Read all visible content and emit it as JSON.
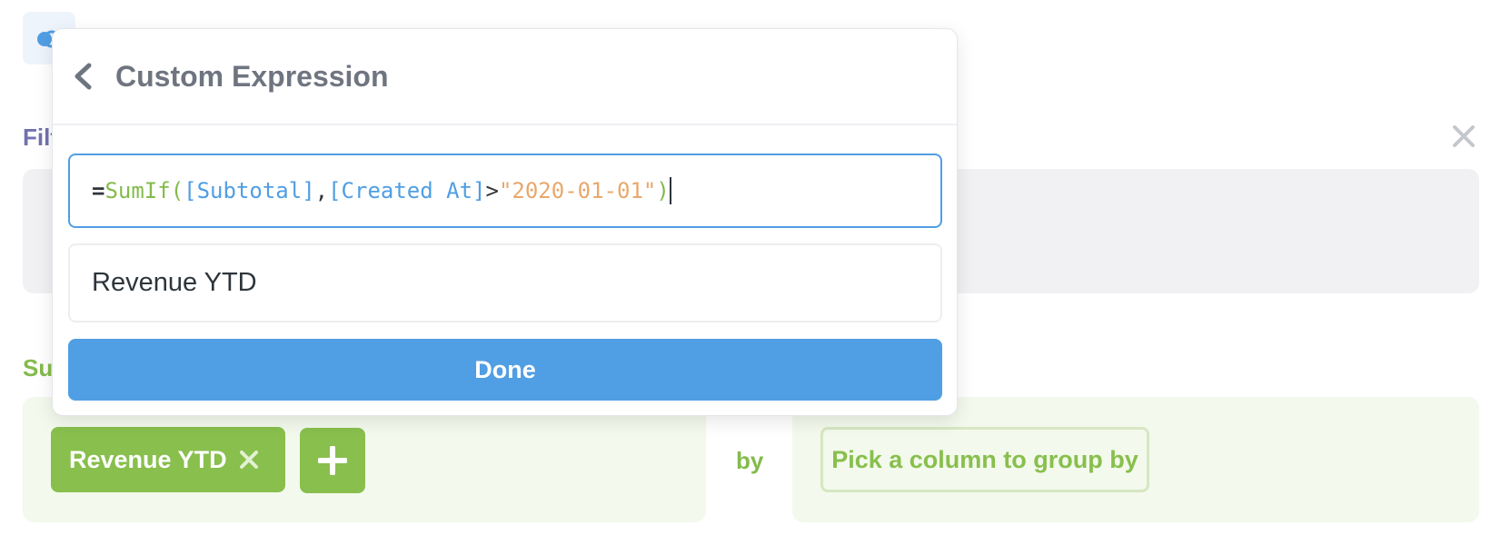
{
  "notebook": {
    "data_icon": "database-icon",
    "filter": {
      "label": "Filter",
      "close_icon": "close-icon"
    },
    "summarize": {
      "label": "Summarize",
      "metric": {
        "label": "Revenue YTD",
        "remove_icon": "close-icon"
      },
      "add_icon": "plus-icon",
      "by_label": "by",
      "groupby_button": "Pick a column to group by"
    }
  },
  "popover": {
    "back_icon": "chevron-left-icon",
    "title": "Custom Expression",
    "expression": {
      "prefix": "=",
      "function": "SumIf(",
      "field1": "[Subtotal]",
      "separator": ",",
      "field2": "[Created At]",
      "operator": ">",
      "string": "\"2020-01-01\"",
      "close": ")"
    },
    "name_value": "Revenue YTD",
    "done_label": "Done"
  },
  "colors": {
    "brand_blue": "#509ee3",
    "summarize_green": "#88bf4d",
    "filter_purple": "#7172ad",
    "string_orange": "#e8a86d"
  }
}
